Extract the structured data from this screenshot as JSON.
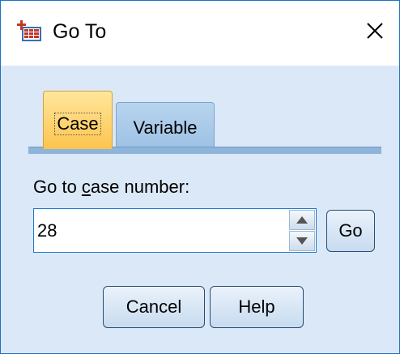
{
  "window": {
    "title": "Go To",
    "app_icon": "data-editor-icon",
    "close_icon": "close-icon"
  },
  "tabs": [
    {
      "label": "Case",
      "selected": true
    },
    {
      "label": "Variable",
      "selected": false
    }
  ],
  "form": {
    "label_prefix": "Go to ",
    "label_mnemonic": "c",
    "label_suffix": "ase number:",
    "case_number": "28"
  },
  "buttons": {
    "go": "Go",
    "cancel": "Cancel",
    "help": "Help"
  },
  "colors": {
    "accent_border": "#1c6fc4",
    "client_bg": "#dbe8f7",
    "selected_tab": "#fdc44e",
    "unselected_tab": "#9ec2e5"
  }
}
